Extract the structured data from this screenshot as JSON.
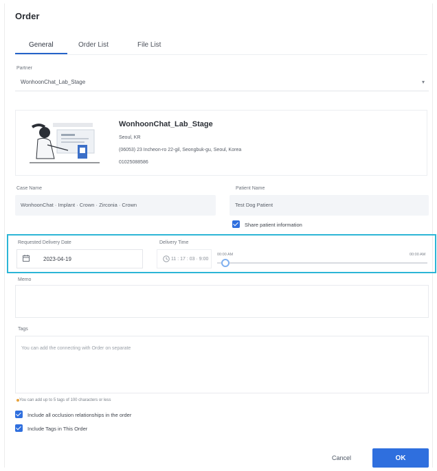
{
  "dialog": {
    "title": "Order"
  },
  "tabs": [
    {
      "label": "General"
    },
    {
      "label": "Order List"
    },
    {
      "label": "File List"
    }
  ],
  "partner": {
    "label": "Partner",
    "value": "WonhoonChat_Lab_Stage"
  },
  "lab_card": {
    "name": "WonhoonChat_Lab_Stage",
    "line1": "Seoul, KR",
    "line2": "(06053) 23 Incheon-ro 22-gil, Seongbuk-gu, Seoul, Korea",
    "line3": "01025088586"
  },
  "case_name": {
    "label": "Case Name",
    "value": "WonhoonChat · Implant · Crown · Zirconia · Crown"
  },
  "patient_name": {
    "label": "Patient Name",
    "value": "Test Dog Patient"
  },
  "share_patient": {
    "label": "Share patient information",
    "checked": true
  },
  "delivery": {
    "date_label": "Requested Delivery Date",
    "date_value": "2023-04-19",
    "time_label": "Delivery Time",
    "time_value": "11 : 17 : 03 · 9:00",
    "slider_min": "00:00 AM",
    "slider_max": "00:00 AM",
    "slider_level": 0.04
  },
  "memo": {
    "label": "Memo",
    "placeholder": ""
  },
  "tags": {
    "label": "Tags",
    "placeholder": "You can add the connecting with Order on separate"
  },
  "note": "You can add up to 5 tags of 100 characters or less",
  "options": [
    {
      "label": "Include all occlusion relationships in the order",
      "checked": true
    },
    {
      "label": "Include Tags in This Order",
      "checked": true
    }
  ],
  "buttons": {
    "cancel": "Cancel",
    "ok": "OK"
  },
  "colors": {
    "accent": "#2f6fde",
    "highlight": "#2bb5d6"
  }
}
